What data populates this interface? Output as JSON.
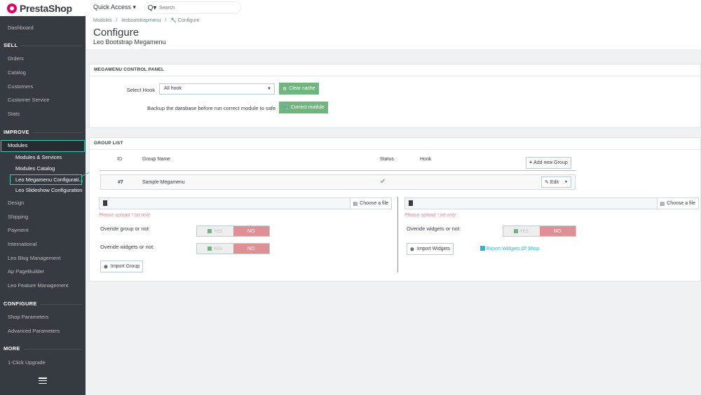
{
  "brand": {
    "name": "PrestaShop"
  },
  "header": {
    "quick_access": "Quick Access ▾",
    "search_placeholder": "Search",
    "search_caret": "Q▾"
  },
  "breadcrumb": {
    "level1": "Modules",
    "sep": "/",
    "level2": "leobootstrapmenu",
    "level3": "Configure"
  },
  "page": {
    "title": "Configure",
    "subtitle": "Leo Bootstrap Megamenu"
  },
  "sidebar": {
    "dashboard": "Dashboard",
    "sell": "SELL",
    "orders": "Orders",
    "catalog": "Catalog",
    "customers": "Customers",
    "customer_service": "Customer Service",
    "stats": "Stats",
    "improve": "IMPROVE",
    "modules": "Modules",
    "modules_services": "Modules & Services",
    "modules_catalog": "Modules Catalog",
    "leo_megamenu": "Leo Megamenu Configurati...",
    "leo_slideshow": "Leo Slideshow Configuration",
    "design": "Design",
    "shipping": "Shipping",
    "payment": "Payment",
    "international": "International",
    "leo_blog": "Leo Blog Management",
    "ap_pagebuilder": "Ap PageBuilder",
    "leo_feature": "Leo Feature Management",
    "configure": "CONFIGURE",
    "shop_params": "Shop Parameters",
    "advanced_params": "Advanced Parameters",
    "more": "MORE",
    "upgrade": "1-Click Upgrade"
  },
  "control_panel": {
    "heading": "MEGAMENU CONTROL PANEL",
    "select_hook_label": "Select Hook",
    "select_hook_value": "All hook",
    "clear_cache": "Clear cache",
    "backup_label": "Backup the database before run correct module to safe",
    "correct_module": "Correct module"
  },
  "group_list": {
    "heading": "GROUP LIST",
    "col_id": "ID",
    "col_name": "Group Name",
    "col_status": "Status",
    "col_hook": "Hook",
    "add_new": "Add new Group",
    "row": {
      "id": "#7",
      "name": "Sample Megamenu",
      "edit": "Edit"
    },
    "choose_file": "Choose a file",
    "hint": "Please upload *.txt only",
    "override_group": "Overide group or not:",
    "override_widgets": "Overide widgets or not:",
    "override_widgets_right": "Overide widgets or not:",
    "yes": "YES",
    "no": "NO",
    "import_group": "Import Group",
    "import_widgets": "Import Widgets",
    "export_widgets": "Export Widgets Of Shop"
  },
  "colors": {
    "accent": "#25b9d7",
    "sidebar_bg": "#363a41",
    "green": "#70b580",
    "no_red": "#e08f95"
  }
}
